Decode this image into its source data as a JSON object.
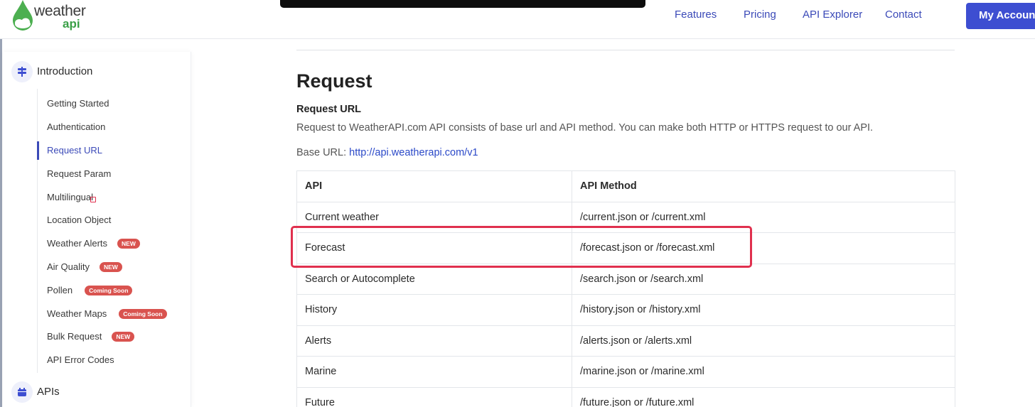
{
  "header": {
    "logo_word1": "weather",
    "logo_word2": "api",
    "nav": [
      "Features",
      "Pricing",
      "API Explorer",
      "Contact"
    ],
    "account_button": "My Account"
  },
  "sidebar": {
    "section_intro": "Introduction",
    "items": [
      {
        "label": "Getting Started",
        "badge": ""
      },
      {
        "label": "Authentication",
        "badge": ""
      },
      {
        "label": "Request URL",
        "badge": "",
        "active": true
      },
      {
        "label": "Request Param",
        "badge": ""
      },
      {
        "label": "Multilingual",
        "badge": ""
      },
      {
        "label": "Location Object",
        "badge": ""
      },
      {
        "label": "Weather Alerts",
        "badge": "NEW"
      },
      {
        "label": "Air Quality",
        "badge": "NEW"
      },
      {
        "label": "Pollen",
        "badge": "Coming Soon"
      },
      {
        "label": "Weather Maps",
        "badge": "Coming Soon"
      },
      {
        "label": "Bulk Request",
        "badge": "NEW"
      },
      {
        "label": "API Error Codes",
        "badge": ""
      }
    ],
    "section_apis": "APIs"
  },
  "content": {
    "title": "Request",
    "subtitle": "Request URL",
    "description": "Request to WeatherAPI.com API consists of base url and API method. You can make both HTTP or HTTPS request to our API.",
    "base_url_label": "Base URL: ",
    "base_url": "http://api.weatherapi.com/v1",
    "table": {
      "headers": [
        "API",
        "API Method"
      ],
      "rows": [
        [
          "Current weather",
          "/current.json or /current.xml"
        ],
        [
          "Forecast",
          "/forecast.json or /forecast.xml"
        ],
        [
          "Search or Autocomplete",
          "/search.json or /search.xml"
        ],
        [
          "History",
          "/history.json or /history.xml"
        ],
        [
          "Alerts",
          "/alerts.json or /alerts.xml"
        ],
        [
          "Marine",
          "/marine.json or /marine.xml"
        ],
        [
          "Future",
          "/future.json or /future.xml"
        ]
      ]
    }
  },
  "colors": {
    "accent": "#3d4ed1",
    "link": "#2b49c8",
    "highlight": "#e0304e",
    "badge": "#d9534f",
    "logo_green": "#3aa047"
  }
}
